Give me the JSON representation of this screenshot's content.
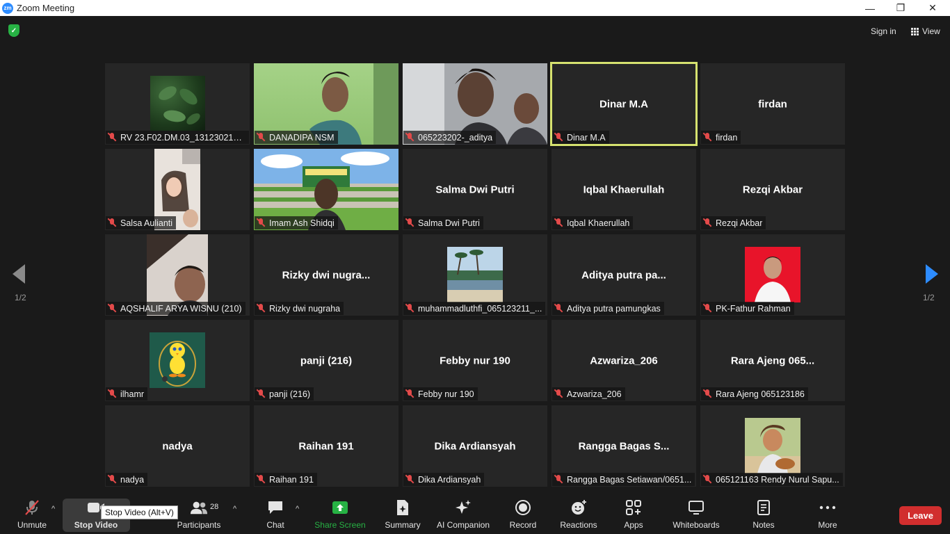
{
  "window": {
    "title": "Zoom Meeting",
    "app_icon_text": "zm",
    "minimize": "—",
    "maximize": "❐",
    "close": "✕"
  },
  "topbar": {
    "sign_in": "Sign in",
    "view": "View",
    "accent_green": "#27b244"
  },
  "pagination": {
    "left_page": "1/2",
    "right_page": "1/2",
    "arrow_right_color": "#2d8cff"
  },
  "tiles": [
    {
      "label": "RV 23.F02.DM.03_1312302143...",
      "center": ""
    },
    {
      "label": "DANADIPA NSM",
      "center": ""
    },
    {
      "label": "065223202-_aditya",
      "center": ""
    },
    {
      "label": "Dinar M.A",
      "center": "Dinar M.A"
    },
    {
      "label": "firdan",
      "center": "firdan"
    },
    {
      "label": "Salsa Aulianti",
      "center": ""
    },
    {
      "label": "Imam Ash Shidqi",
      "center": ""
    },
    {
      "label": "Salma Dwi Putri",
      "center": "Salma Dwi Putri"
    },
    {
      "label": "Iqbal Khaerullah",
      "center": "Iqbal Khaerullah"
    },
    {
      "label": "Rezqi Akbar",
      "center": "Rezqi Akbar"
    },
    {
      "label": "AQSHALIF ARYA WISNU (210)",
      "center": ""
    },
    {
      "label": "Rizky dwi nugraha",
      "center": "Rizky  dwi  nugra..."
    },
    {
      "label": "muhammadluthfi_065123211_...",
      "center": ""
    },
    {
      "label": "Aditya putra pamungkas",
      "center": "Aditya  putra  pa..."
    },
    {
      "label": "PK-Fathur Rahman",
      "center": ""
    },
    {
      "label": "ilhamr",
      "center": ""
    },
    {
      "label": "panji (216)",
      "center": "panji (216)"
    },
    {
      "label": "Febby nur 190",
      "center": "Febby nur 190"
    },
    {
      "label": "Azwariza_206",
      "center": "Azwariza_206"
    },
    {
      "label": "Rara Ajeng 065123186",
      "center": "Rara Ajeng 065..."
    },
    {
      "label": "nadya",
      "center": "nadya"
    },
    {
      "label": "Raihan 191",
      "center": "Raihan 191"
    },
    {
      "label": "Dika Ardiansyah",
      "center": "Dika Ardiansyah"
    },
    {
      "label": "Rangga Bagas Setiawan/0651...",
      "center": "Rangga  Bagas  S..."
    },
    {
      "label": "065121163 Rendy Nurul Sapu...",
      "center": ""
    }
  ],
  "toolbar": {
    "unmute": "Unmute",
    "stop_video": "Stop Video",
    "participants": "Participants",
    "participants_count": "28",
    "chat": "Chat",
    "share_screen": "Share Screen",
    "summary": "Summary",
    "ai_companion": "AI Companion",
    "record": "Record",
    "reactions": "Reactions",
    "apps": "Apps",
    "whiteboards": "Whiteboards",
    "notes": "Notes",
    "more": "More",
    "leave": "Leave",
    "tooltip": "Stop Video (Alt+V)",
    "share_color": "#27b244",
    "leave_color": "#d12e2e"
  }
}
